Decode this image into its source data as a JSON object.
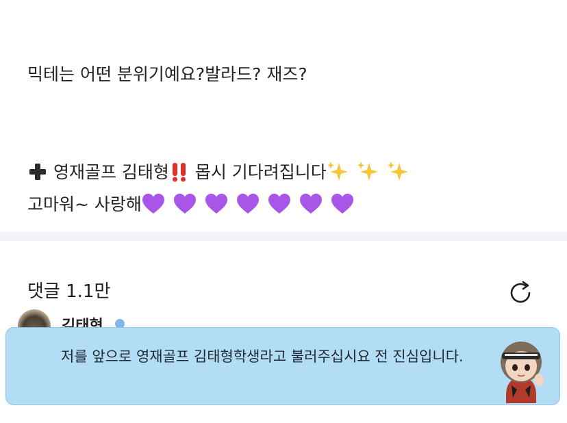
{
  "post": {
    "line1": "믹테는 어떤 분위기예요?발라드? 재즈?",
    "line2_text": "영재골프 김태형",
    "line2_tail": "몹시 기다려집니다",
    "line3_text": "고마워~ 사랑해"
  },
  "comments": {
    "title": "댓글 1.1만"
  },
  "pinned_comment": {
    "author": "김태형",
    "text": "저를 앞으로 영재골프 김태형학생라고 불러주십시요 전 진심입니다."
  },
  "icons": {
    "plus": "heavy-plus-icon",
    "exclaim": "double-exclamation-icon",
    "sparkles": "sparkles-icon",
    "heart": "purple-heart-icon",
    "refresh": "refresh-icon"
  },
  "colors": {
    "accent_blue": "#b3dcf5",
    "heart_purple": "#a855e8",
    "exclaim_red": "#e0312b",
    "sparkle_yellow": "#f4c73b"
  }
}
